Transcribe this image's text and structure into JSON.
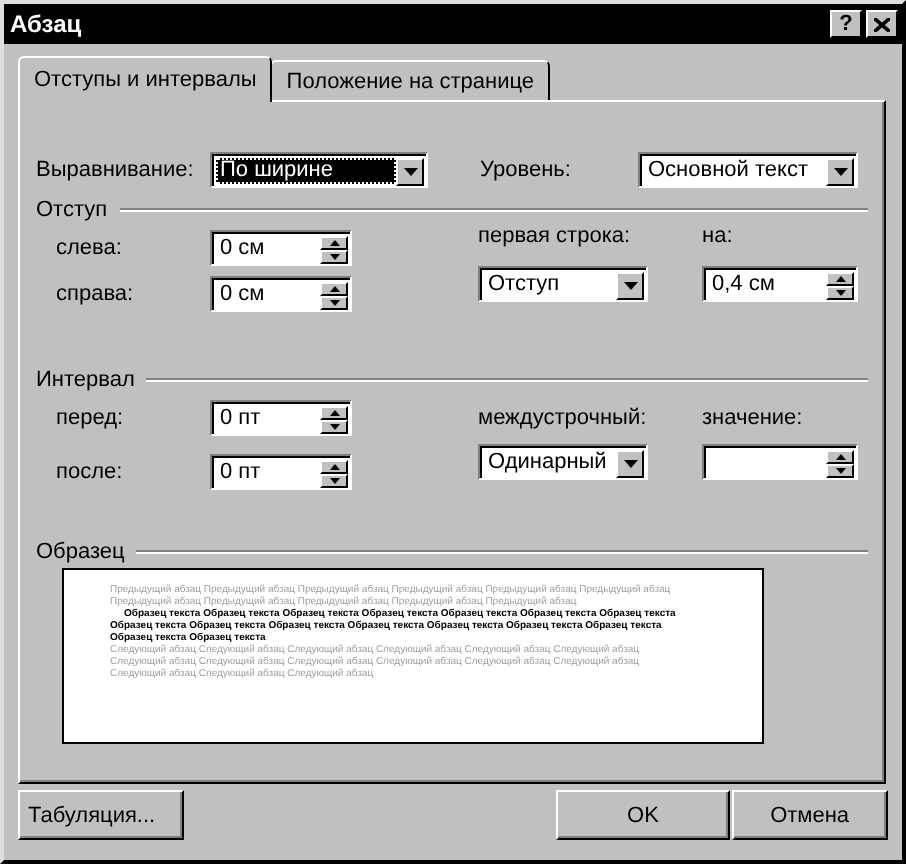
{
  "window": {
    "title": "Абзац",
    "help_label": "?"
  },
  "tabs": [
    {
      "label": "Отступы и интервалы",
      "selected": true
    },
    {
      "label": "Положение на странице",
      "selected": false
    }
  ],
  "alignment": {
    "label": "Выравнивание:",
    "value": "По ширине",
    "focused": true
  },
  "outline_level": {
    "label": "Уровень:",
    "value": "Основной текст",
    "focused": false
  },
  "indent": {
    "title": "Отступ",
    "left": {
      "label": "слева:",
      "value": "0 см"
    },
    "right": {
      "label": "справа:",
      "value": "0 см"
    },
    "first_line": {
      "label": "первая строка:",
      "value": "Отступ"
    },
    "by": {
      "label": "на:",
      "value": "0,4 см"
    }
  },
  "spacing": {
    "title": "Интервал",
    "before": {
      "label": "перед:",
      "value": "0 пт"
    },
    "after": {
      "label": "после:",
      "value": "0 пт"
    },
    "line_spacing": {
      "label": "междустрочный:",
      "value": "Одинарный"
    },
    "at": {
      "label": "значение:"
    }
  },
  "preview": {
    "title": "Образец",
    "previous": "Предыдущий абзац Предыдущий абзац Предыдущий абзац Предыдущий абзац Предыдущий абзац Предыдущий абзац Предыдущий абзац Предыдущий абзац Предыдущий абзац Предыдущий абзац Предыдущий абзац",
    "sample": "Образец текста Образец текста Образец текста Образец текста Образец текста Образец текста Образец текста Образец текста Образец текста Образец текста Образец текста Образец текста Образец текста Образец текста Образец текста Образец текста",
    "next": "Следующий абзац Следующий абзац Следующий абзац Следующий абзац Следующий абзац Следующий абзац Следующий абзац Следующий абзац Следующий абзац Следующий абзац Следующий абзац Следующий абзац Следующий абзац Следующий абзац Следующий абзац"
  },
  "buttons": {
    "tabs": "Табуляция...",
    "ok": "OK",
    "cancel": "Отмена"
  }
}
